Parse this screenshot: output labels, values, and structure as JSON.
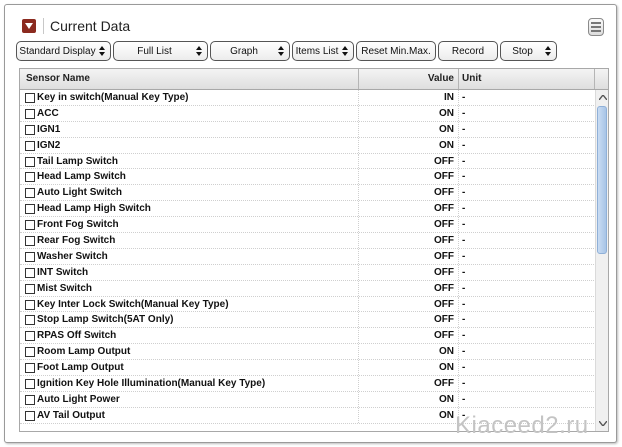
{
  "window": {
    "title": "Current Data"
  },
  "toolbar": {
    "buttons": [
      {
        "label": "Standard Display",
        "dropdown": true
      },
      {
        "label": "Full List",
        "dropdown": true
      },
      {
        "label": "Graph",
        "dropdown": true
      },
      {
        "label": "Items List",
        "dropdown": true
      },
      {
        "label": "Reset Min.Max.",
        "dropdown": false
      },
      {
        "label": "Record",
        "dropdown": false
      },
      {
        "label": "Stop",
        "dropdown": true
      }
    ]
  },
  "table": {
    "columns": {
      "name": "Sensor Name",
      "value": "Value",
      "unit": "Unit"
    },
    "rows": [
      {
        "name": "Key in switch(Manual Key Type)",
        "value": "IN",
        "unit": "-"
      },
      {
        "name": "ACC",
        "value": "ON",
        "unit": "-"
      },
      {
        "name": "IGN1",
        "value": "ON",
        "unit": "-"
      },
      {
        "name": "IGN2",
        "value": "ON",
        "unit": "-"
      },
      {
        "name": "Tail Lamp Switch",
        "value": "OFF",
        "unit": "-"
      },
      {
        "name": "Head Lamp Switch",
        "value": "OFF",
        "unit": "-"
      },
      {
        "name": "Auto Light Switch",
        "value": "OFF",
        "unit": "-"
      },
      {
        "name": "Head Lamp High Switch",
        "value": "OFF",
        "unit": "-"
      },
      {
        "name": "Front Fog Switch",
        "value": "OFF",
        "unit": "-"
      },
      {
        "name": "Rear Fog Switch",
        "value": "OFF",
        "unit": "-"
      },
      {
        "name": "Washer Switch",
        "value": "OFF",
        "unit": "-"
      },
      {
        "name": "INT Switch",
        "value": "OFF",
        "unit": "-"
      },
      {
        "name": "Mist Switch",
        "value": "OFF",
        "unit": "-"
      },
      {
        "name": "Key Inter Lock Switch(Manual Key Type)",
        "value": "OFF",
        "unit": "-"
      },
      {
        "name": "Stop Lamp Switch(5AT Only)",
        "value": "OFF",
        "unit": "-"
      },
      {
        "name": "RPAS Off Switch",
        "value": "OFF",
        "unit": "-"
      },
      {
        "name": "Room Lamp Output",
        "value": "ON",
        "unit": "-"
      },
      {
        "name": "Foot Lamp Output",
        "value": "ON",
        "unit": "-"
      },
      {
        "name": "Ignition Key Hole Illumination(Manual Key Type)",
        "value": "OFF",
        "unit": "-"
      },
      {
        "name": "Auto Light Power",
        "value": "ON",
        "unit": "-"
      },
      {
        "name": "AV Tail Output",
        "value": "ON",
        "unit": "-"
      }
    ]
  },
  "watermark": "Kiaceed2.ru",
  "colors": {
    "collapse_button": "#8b2a1f",
    "scroll_thumb": "#a8c4e6"
  },
  "icons": {
    "collapse": "chevron-down-icon",
    "menu": "menu-icon",
    "scroll_up": "arrow-up-icon",
    "scroll_down": "arrow-down-icon"
  }
}
